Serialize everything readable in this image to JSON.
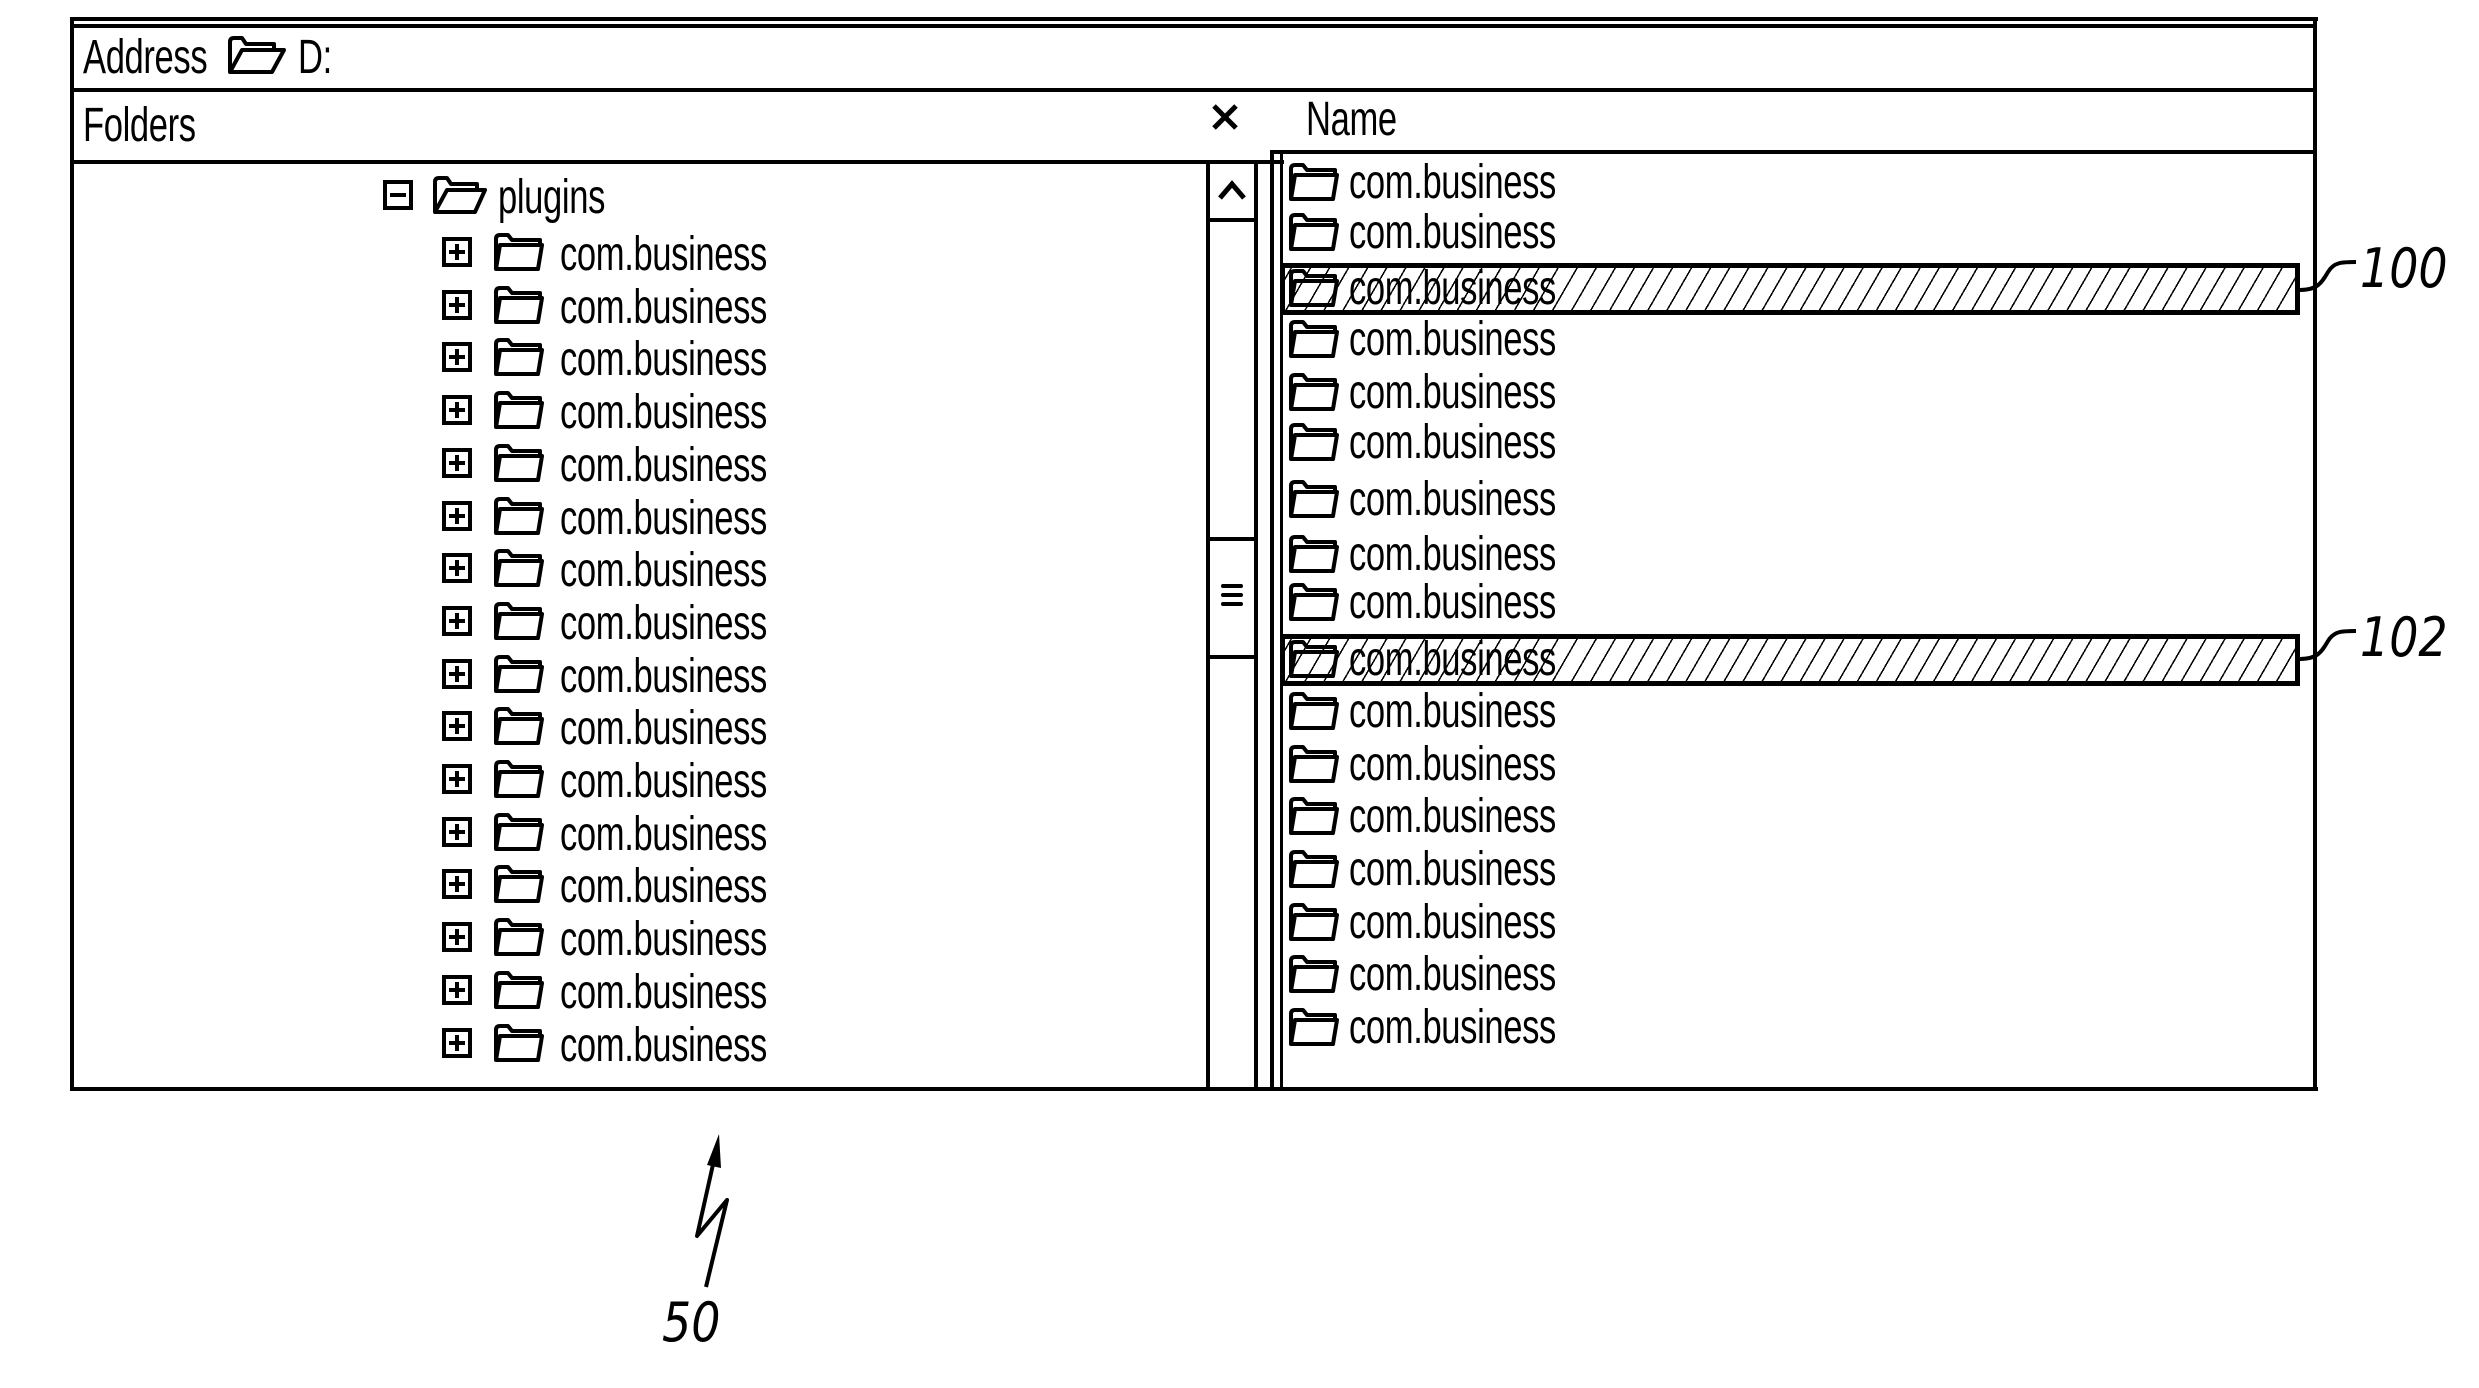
{
  "address_bar": {
    "label": "Address",
    "icon": "open-folder-icon",
    "value": "D:"
  },
  "folders_pane": {
    "header": "Folders",
    "close_icon": "close-icon",
    "close_glyph": "×",
    "root": {
      "label": "plugins",
      "toggle": "collapse",
      "toggle_icon": "minus-box-icon",
      "icon": "open-folder-icon"
    },
    "children": [
      {
        "label": "com.business",
        "toggle": "expand"
      },
      {
        "label": "com.business",
        "toggle": "expand"
      },
      {
        "label": "com.business",
        "toggle": "expand"
      },
      {
        "label": "com.business",
        "toggle": "expand"
      },
      {
        "label": "com.business",
        "toggle": "expand"
      },
      {
        "label": "com.business",
        "toggle": "expand"
      },
      {
        "label": "com.business",
        "toggle": "expand"
      },
      {
        "label": "com.business",
        "toggle": "expand"
      },
      {
        "label": "com.business",
        "toggle": "expand"
      },
      {
        "label": "com.business",
        "toggle": "expand"
      },
      {
        "label": "com.business",
        "toggle": "expand"
      },
      {
        "label": "com.business",
        "toggle": "expand"
      },
      {
        "label": "com.business",
        "toggle": "expand"
      },
      {
        "label": "com.business",
        "toggle": "expand"
      },
      {
        "label": "com.business",
        "toggle": "expand"
      },
      {
        "label": "com.business",
        "toggle": "expand"
      }
    ],
    "scrollbar": {
      "up_glyph": "^",
      "thumb_glyph": "≡"
    }
  },
  "contents_pane": {
    "column_header": "Name",
    "items": [
      {
        "label": "com.business",
        "highlighted": false
      },
      {
        "label": "com.business",
        "highlighted": false
      },
      {
        "label": "com.business",
        "highlighted": true,
        "ref": "100"
      },
      {
        "label": "com.business",
        "highlighted": false
      },
      {
        "label": "com.business",
        "highlighted": false
      },
      {
        "label": "com.business",
        "highlighted": false
      },
      {
        "label": "com.business",
        "highlighted": false
      },
      {
        "label": "com.business",
        "highlighted": false
      },
      {
        "label": "com.business",
        "highlighted": false
      },
      {
        "label": "com.business",
        "highlighted": true,
        "ref": "102"
      },
      {
        "label": "com.business",
        "highlighted": false
      },
      {
        "label": "com.business",
        "highlighted": false
      },
      {
        "label": "com.business",
        "highlighted": false
      },
      {
        "label": "com.business",
        "highlighted": false
      },
      {
        "label": "com.business",
        "highlighted": false
      },
      {
        "label": "com.business",
        "highlighted": false
      },
      {
        "label": "com.business",
        "highlighted": false
      }
    ]
  },
  "figure_reference": {
    "label": "50"
  }
}
